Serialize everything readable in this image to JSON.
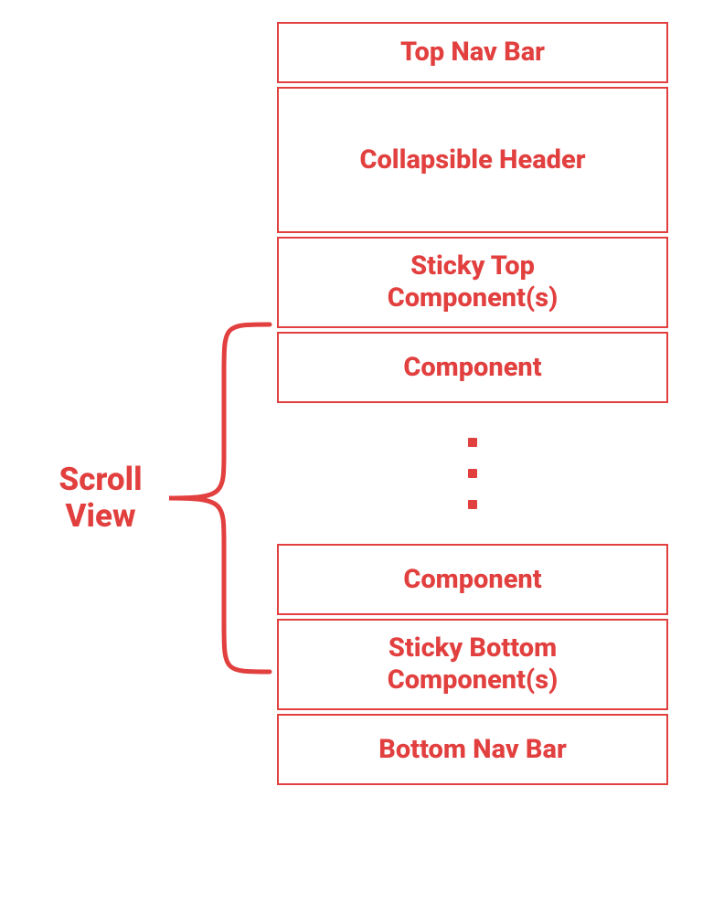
{
  "label": {
    "line1": "Scroll",
    "line2": "View"
  },
  "boxes": {
    "top_nav": "Top Nav Bar",
    "collapsible": "Collapsible Header",
    "sticky_top_line1": "Sticky Top",
    "sticky_top_line2": "Component(s)",
    "component": "Component",
    "component2": "Component",
    "sticky_bottom_line1": "Sticky Bottom",
    "sticky_bottom_line2": "Component(s)",
    "bottom_nav": "Bottom Nav Bar"
  },
  "colors": {
    "primary": "#e23f3f"
  }
}
